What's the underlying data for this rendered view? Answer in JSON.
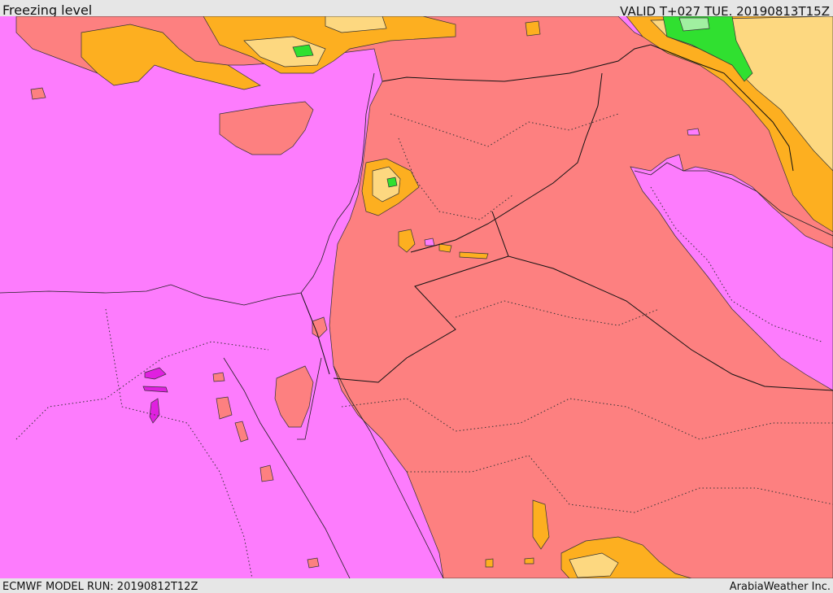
{
  "header": {
    "title": "Freezing level",
    "valid": "VALID T+027 TUE. 20190813T15Z"
  },
  "footer": {
    "model_run": "ECMWF MODEL RUN: 20190812T12Z",
    "credit": "ArabiaWeather Inc."
  },
  "map": {
    "colors": {
      "level_magenta": "#ff7dff",
      "level_salmon": "#fd8080",
      "level_orange": "#fdaf20",
      "level_light_orange": "#fdd880",
      "level_green": "#30e030",
      "level_light_green": "#a0f0a0",
      "level_deep_magenta": "#e020e0"
    }
  }
}
